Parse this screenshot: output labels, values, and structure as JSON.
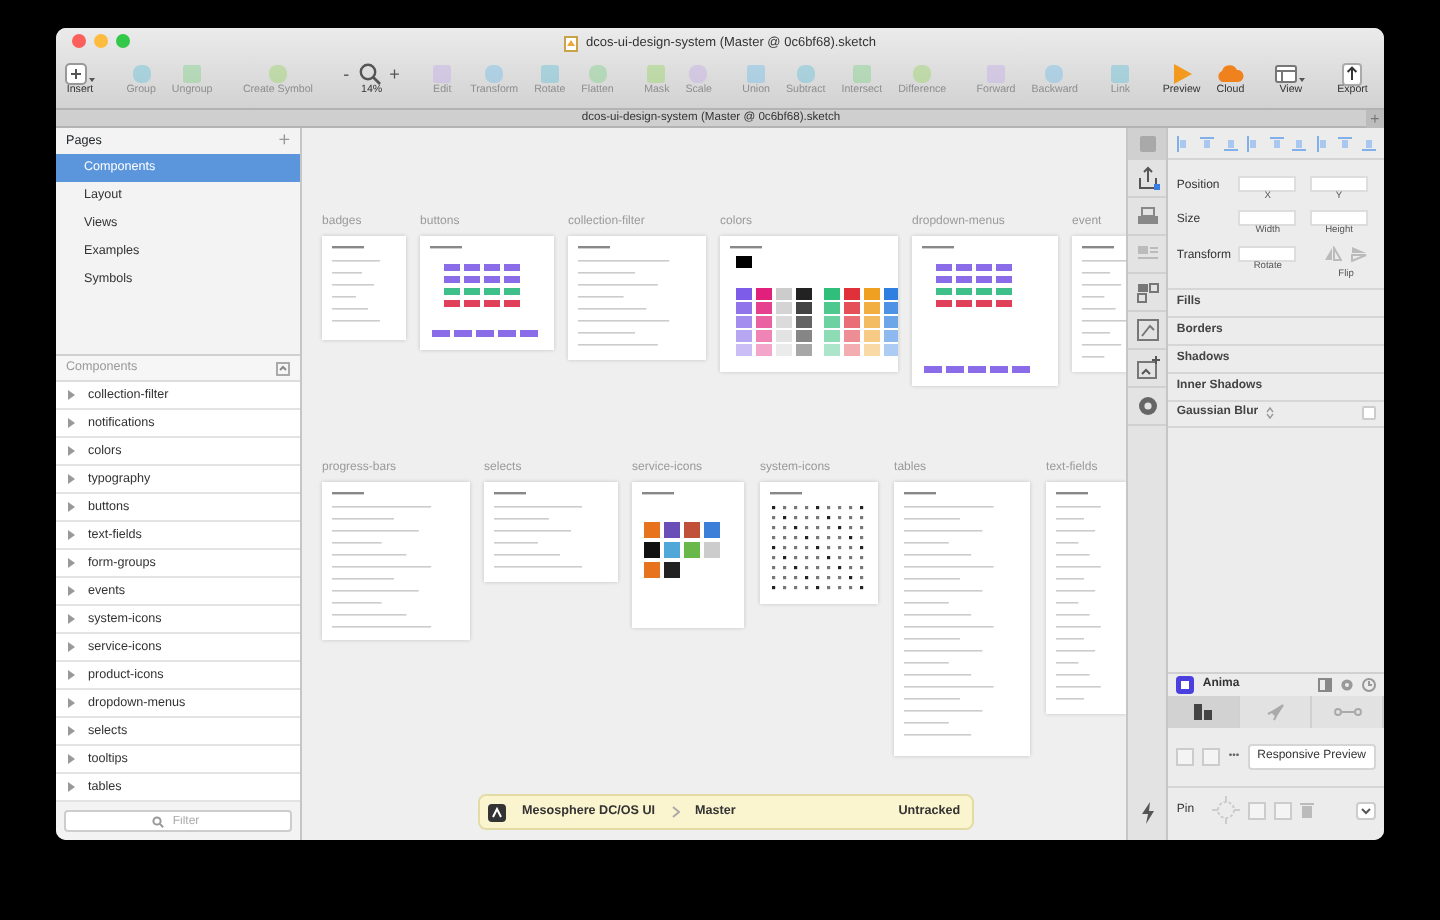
{
  "window": {
    "title": "dcos-ui-design-system (Master @ 0c6bf68).sketch"
  },
  "toolbar": {
    "groups": [
      [
        {
          "label": "Insert",
          "kind": "plus",
          "disabled": false
        }
      ],
      [
        {
          "label": "Group",
          "kind": "shape",
          "disabled": true
        },
        {
          "label": "Ungroup",
          "kind": "shape",
          "disabled": true
        }
      ],
      [
        {
          "label": "Create Symbol",
          "kind": "shape",
          "disabled": true
        }
      ],
      [
        {
          "label": "14%",
          "kind": "zoom",
          "minus": "-",
          "plus": "+",
          "disabled": false
        }
      ],
      [
        {
          "label": "Edit",
          "kind": "shape",
          "disabled": true
        },
        {
          "label": "Transform",
          "kind": "shape",
          "disabled": true
        },
        {
          "label": "Rotate",
          "kind": "shape",
          "disabled": true
        },
        {
          "label": "Flatten",
          "kind": "shape",
          "disabled": true
        }
      ],
      [
        {
          "label": "Mask",
          "kind": "shape",
          "disabled": true
        },
        {
          "label": "Scale",
          "kind": "shape",
          "disabled": true
        }
      ],
      [
        {
          "label": "Union",
          "kind": "shape",
          "disabled": true
        },
        {
          "label": "Subtract",
          "kind": "shape",
          "disabled": true
        },
        {
          "label": "Intersect",
          "kind": "shape",
          "disabled": true
        },
        {
          "label": "Difference",
          "kind": "shape",
          "disabled": true
        }
      ],
      [
        {
          "label": "Forward",
          "kind": "shape",
          "disabled": true
        },
        {
          "label": "Backward",
          "kind": "shape",
          "disabled": true
        }
      ],
      [
        {
          "label": "Link",
          "kind": "shape",
          "disabled": true
        }
      ],
      [
        {
          "label": "Preview",
          "kind": "play",
          "disabled": false
        },
        {
          "label": "Cloud",
          "kind": "cloud",
          "disabled": false
        }
      ],
      [
        {
          "label": "View",
          "kind": "view",
          "disabled": false
        }
      ],
      [
        {
          "label": "Export",
          "kind": "export",
          "disabled": false
        }
      ]
    ]
  },
  "tab_bar": {
    "title": "dcos-ui-design-system (Master @ 0c6bf68).sketch",
    "add": "+"
  },
  "sidebar": {
    "pages": {
      "title": "Pages",
      "add": "+",
      "items": [
        {
          "label": "Components",
          "selected": true
        },
        {
          "label": "Layout",
          "selected": false
        },
        {
          "label": "Views",
          "selected": false
        },
        {
          "label": "Examples",
          "selected": false
        },
        {
          "label": "Symbols",
          "selected": false
        }
      ]
    },
    "layers": {
      "title": "Components",
      "items": [
        {
          "label": "collection-filter",
          "expanded": false
        },
        {
          "label": "notifications",
          "expanded": false
        },
        {
          "label": "colors",
          "expanded": false
        },
        {
          "label": "typography",
          "expanded": false
        },
        {
          "label": "buttons",
          "expanded": false
        },
        {
          "label": "text-fields",
          "expanded": false
        },
        {
          "label": "form-groups",
          "expanded": false
        },
        {
          "label": "events",
          "expanded": false
        },
        {
          "label": "system-icons",
          "expanded": false
        },
        {
          "label": "service-icons",
          "expanded": false
        },
        {
          "label": "product-icons",
          "expanded": false
        },
        {
          "label": "dropdown-menus",
          "expanded": false
        },
        {
          "label": "selects",
          "expanded": false
        },
        {
          "label": "tooltips",
          "expanded": false
        },
        {
          "label": "tables",
          "expanded": false
        }
      ]
    },
    "filter": {
      "placeholder": "Filter"
    }
  },
  "canvas": {
    "rows": [
      [
        {
          "title": "badges",
          "kind": "list"
        },
        {
          "title": "buttons",
          "kind": "grid"
        },
        {
          "title": "collection-filter",
          "kind": "list"
        },
        {
          "title": "colors",
          "kind": "swatches"
        },
        {
          "title": "dropdown-menus",
          "kind": "grid"
        },
        {
          "title": "event",
          "kind": "list"
        }
      ],
      [
        {
          "title": "progress-bars",
          "kind": "list"
        },
        {
          "title": "selects",
          "kind": "list"
        },
        {
          "title": "service-icons",
          "kind": "icons"
        },
        {
          "title": "system-icons",
          "kind": "dots"
        },
        {
          "title": "tables",
          "kind": "list"
        },
        {
          "title": "text-fields",
          "kind": "list"
        }
      ]
    ]
  },
  "status": {
    "project": "Mesosphere DC/OS UI",
    "branch": "Master",
    "state": "Untracked"
  },
  "inspector": {
    "rows": [
      {
        "label": "Position",
        "fields": [
          {
            "caption": "X"
          },
          {
            "caption": "Y"
          }
        ]
      },
      {
        "label": "Size",
        "fields": [
          {
            "caption": "Width"
          },
          {
            "caption": "Height"
          }
        ]
      },
      {
        "label": "Transform",
        "fields": [
          {
            "caption": "Rotate"
          }
        ],
        "flip": "Flip"
      }
    ],
    "sections": [
      "Fills",
      "Borders",
      "Shadows",
      "Inner Shadows"
    ],
    "blur": {
      "label": "Gaussian Blur",
      "checked": false
    }
  },
  "anima": {
    "title": "Anima",
    "tabs": [
      {
        "kind": "bars",
        "selected": true
      },
      {
        "kind": "rocket",
        "selected": false
      },
      {
        "kind": "link",
        "selected": false
      }
    ],
    "more": "•••",
    "preview": "Responsive Preview",
    "pin": "Pin"
  }
}
